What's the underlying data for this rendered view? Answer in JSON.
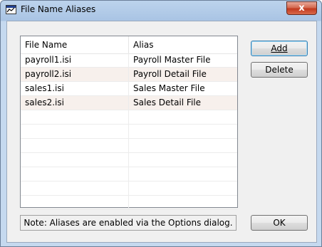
{
  "window": {
    "title": "File Name Aliases",
    "close_label": "x"
  },
  "list": {
    "columns": [
      "File Name",
      "Alias"
    ],
    "rows": [
      {
        "name": "payroll1.isi",
        "alias": "Payroll Master File"
      },
      {
        "name": "payroll2.isi",
        "alias": "Payroll Detail File"
      },
      {
        "name": "sales1.isi",
        "alias": "Sales Master File"
      },
      {
        "name": "sales2.isi",
        "alias": "Sales Detail File"
      },
      {
        "name": "",
        "alias": ""
      },
      {
        "name": "",
        "alias": ""
      },
      {
        "name": "",
        "alias": ""
      },
      {
        "name": "",
        "alias": ""
      },
      {
        "name": "",
        "alias": ""
      },
      {
        "name": "",
        "alias": ""
      },
      {
        "name": "",
        "alias": ""
      }
    ]
  },
  "buttons": {
    "add_label": "Add",
    "delete_label": "Delete",
    "ok_label": "OK"
  },
  "note": "Note: Aliases are enabled via the Options dialog.",
  "icons": {
    "app": "chart-window-icon",
    "close": "close-icon"
  },
  "colors": {
    "alt_row": "#f7f0ec",
    "close_button": "#c13a1f",
    "default_button_border": "#3c7fb1"
  }
}
